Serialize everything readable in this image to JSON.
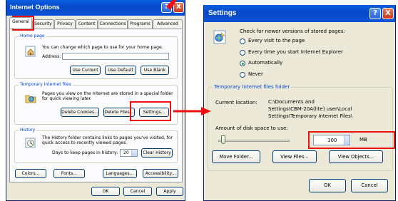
{
  "left_window": {
    "title": "Internet Options",
    "tabs": [
      {
        "label": "General"
      },
      {
        "label": "Security"
      },
      {
        "label": "Privacy"
      },
      {
        "label": "Content"
      },
      {
        "label": "Connections"
      },
      {
        "label": "Programs"
      },
      {
        "label": "Advanced"
      }
    ],
    "home_page": {
      "title": "Home page",
      "desc": "You can change which page to use for your home page.",
      "address_label": "Address:",
      "address_value": "",
      "use_current": "Use Current",
      "use_default": "Use Default",
      "use_blank": "Use Blank"
    },
    "temp_files": {
      "title": "Temporary Internet files",
      "desc_line1": "Pages you view on the Internet are stored in a special folder",
      "desc_line2": "for quick viewing later.",
      "delete_cookies": "Delete Cookies...",
      "delete_files": "Delete Files...",
      "settings": "Settings..."
    },
    "history": {
      "title": "History",
      "desc_line1": "The History folder contains links to pages you've visited, for",
      "desc_line2": "quick access to recently viewed pages.",
      "days_label": "Days to keep pages in history:",
      "days_value": "20",
      "clear": "Clear History"
    },
    "bottom_buttons": {
      "colors": "Colors...",
      "fonts": "Fonts...",
      "languages": "Languages...",
      "accessibility": "Accessibility..."
    },
    "dialog_buttons": {
      "ok": "OK",
      "cancel": "Cancel",
      "apply": "Apply"
    }
  },
  "right_window": {
    "title": "Settings",
    "check_label": "Check for newer versions of stored pages:",
    "options": [
      {
        "label": "Every visit to the page",
        "selected": false
      },
      {
        "label": "Every time you start Internet Explorer",
        "selected": false
      },
      {
        "label": "Automatically",
        "selected": true
      },
      {
        "label": "Never",
        "selected": false
      }
    ],
    "temp_folder": {
      "title": "Temporary Internet files folder",
      "current_location_label": "Current location:",
      "location_line1": "C:\\Documents and",
      "location_line2": "Settings\\CBM-20A(lite) user\\Local",
      "location_line3": "Settings\\Temporary Internet Files\\",
      "disk_space_label": "Amount of disk space to use:",
      "disk_space_value": "100",
      "disk_space_unit": "MB"
    },
    "buttons": {
      "move_folder": "Move Folder...",
      "view_files": "View Files...",
      "view_objects": "View Objects...",
      "ok": "OK",
      "cancel": "Cancel"
    }
  },
  "title_buttons": {
    "help": "?",
    "close": "X"
  },
  "colors": {
    "annotation_red": "#ee1111",
    "xp_title_blue": "#0548c8",
    "group_title_blue": "#0046d5",
    "dialog_face": "#ece9d8"
  },
  "icons": [
    "home-page-icon",
    "temp-files-icon",
    "history-icon",
    "settings-page-icon",
    "arrow-icon"
  ]
}
